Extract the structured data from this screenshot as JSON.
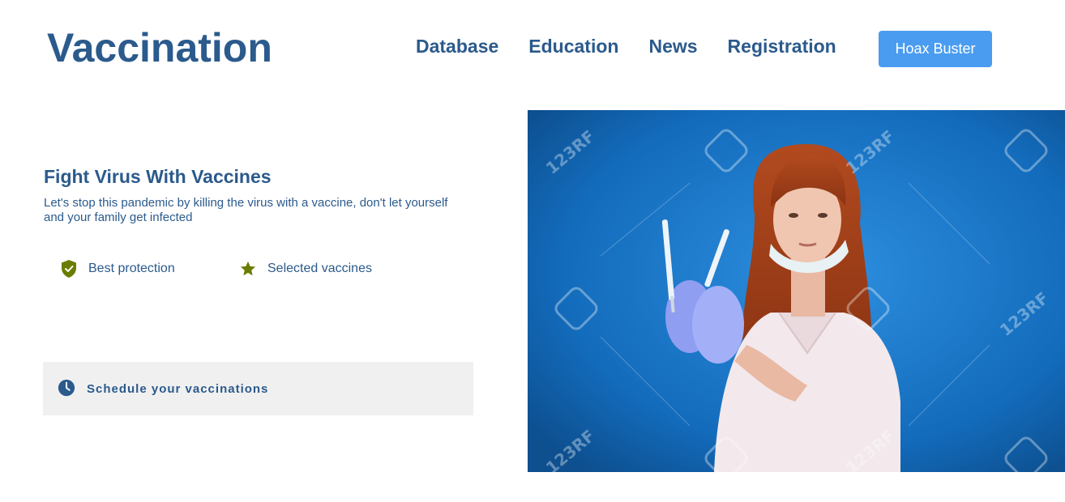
{
  "header": {
    "logo": "Vaccination",
    "nav": [
      "Database",
      "Education",
      "News",
      "Registration"
    ],
    "cta": "Hoax Buster"
  },
  "hero": {
    "title": "Fight Virus With Vaccines",
    "subtitle": "Let's stop this pandemic by killing the virus with a vaccine, don't let yourself and your family get infected",
    "features": [
      {
        "icon": "shield-check-icon",
        "label": "Best protection"
      },
      {
        "icon": "star-icon",
        "label": "Selected vaccines"
      }
    ],
    "schedule": {
      "icon": "clock-icon",
      "label": "Schedule your vaccinations"
    }
  },
  "photo": {
    "description_icon": "doctor-with-syringes-photo",
    "watermark": "123RF"
  },
  "colors": {
    "brand": "#2b5a8c",
    "button": "#4a9cf0",
    "feature_icon": "#6b7c00",
    "photo_bg": "#1a6fbf"
  }
}
